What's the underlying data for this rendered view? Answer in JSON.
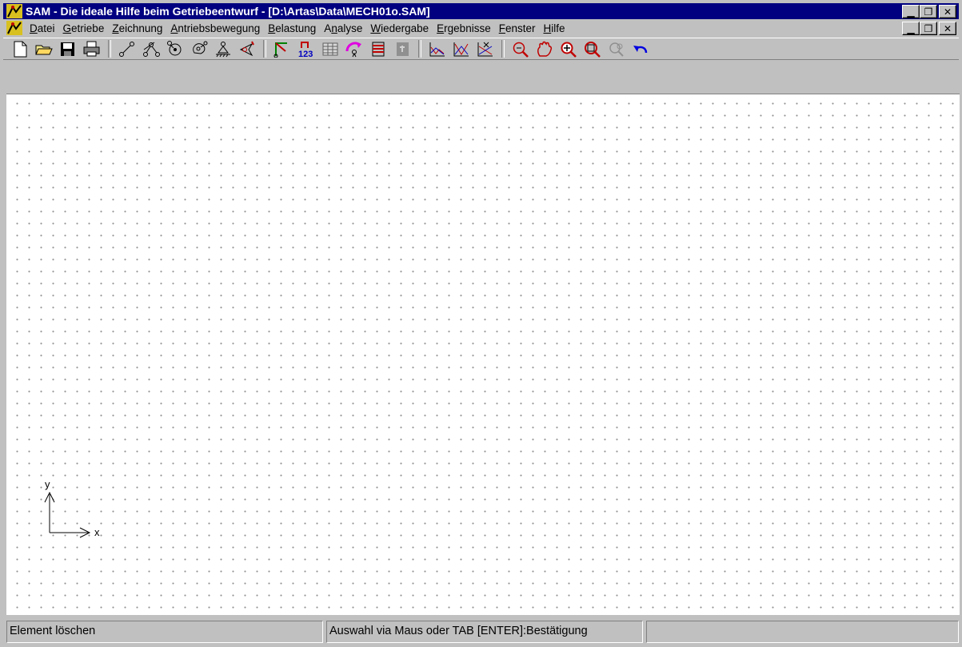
{
  "window": {
    "title": "SAM - Die ideale Hilfe beim Getriebeentwurf - [D:\\Artas\\Data\\MECH01o.SAM]",
    "app_icon": "sam-app-icon",
    "caption_buttons": [
      "minimize",
      "maximize",
      "close"
    ]
  },
  "menu": {
    "items": [
      {
        "accel": "D",
        "rest": "atei"
      },
      {
        "accel": "G",
        "rest": "etriebe"
      },
      {
        "accel": "Z",
        "rest": "eichnung"
      },
      {
        "accel": "A",
        "rest": "ntriebsbewegung"
      },
      {
        "accel": "B",
        "rest": "elastung"
      },
      {
        "pre": "A",
        "accel": "n",
        "rest": "alyse"
      },
      {
        "accel": "W",
        "rest": "iedergabe"
      },
      {
        "accel": "E",
        "rest": "rgebnisse"
      },
      {
        "accel": "F",
        "rest": "enster"
      },
      {
        "accel": "H",
        "rest": "ilfe"
      }
    ]
  },
  "toolbar": {
    "groups": [
      [
        "new-file-icon",
        "open-folder-icon",
        "save-disk-icon",
        "print-icon"
      ],
      [
        "link-icon",
        "joint-link-icon",
        "gear-icon",
        "cam-icon",
        "ground-support-icon",
        "slider-icon"
      ],
      [
        "motion-path-icon",
        "numbering-icon",
        "table-icon",
        "rotation-drive-icon",
        "load-frame-icon",
        "disabled-tool-icon"
      ],
      [
        "graph-1-icon",
        "graph-2-icon",
        "graph-3-icon"
      ],
      [
        "zoom-out-icon",
        "pan-hand-icon",
        "zoom-in-icon",
        "zoom-window-icon",
        "zoom-disabled-icon",
        "undo-icon"
      ]
    ]
  },
  "canvas": {
    "axis_x_label": "x",
    "axis_y_label": "y"
  },
  "status": {
    "pane1": "Element löschen",
    "pane2": "Auswahl via Maus oder TAB [ENTER]:Bestätigung",
    "pane3": ""
  },
  "colors": {
    "titlebar": "#000080",
    "face": "#c0c0c0",
    "grid_dot": "#909090"
  }
}
